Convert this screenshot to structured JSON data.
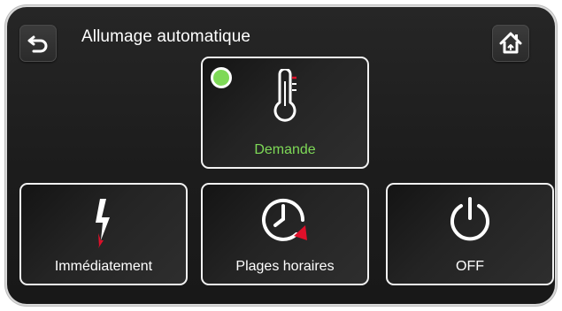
{
  "header": {
    "title": "Allumage automatique",
    "back_icon": "back-arrow-icon",
    "home_icon": "home-icon"
  },
  "modes": [
    {
      "label": "Demande",
      "icon": "thermometer-icon",
      "selected": true
    },
    {
      "label": "Immédiatement",
      "icon": "lightning-icon",
      "selected": false
    },
    {
      "label": "Plages horaires",
      "icon": "clock-icon",
      "selected": false
    },
    {
      "label": "OFF",
      "icon": "power-icon",
      "selected": false
    }
  ],
  "colors": {
    "active": "#7ed957",
    "accent_red": "#e0102a",
    "background": "#1e1e1e",
    "border": "#f2f2f2"
  }
}
